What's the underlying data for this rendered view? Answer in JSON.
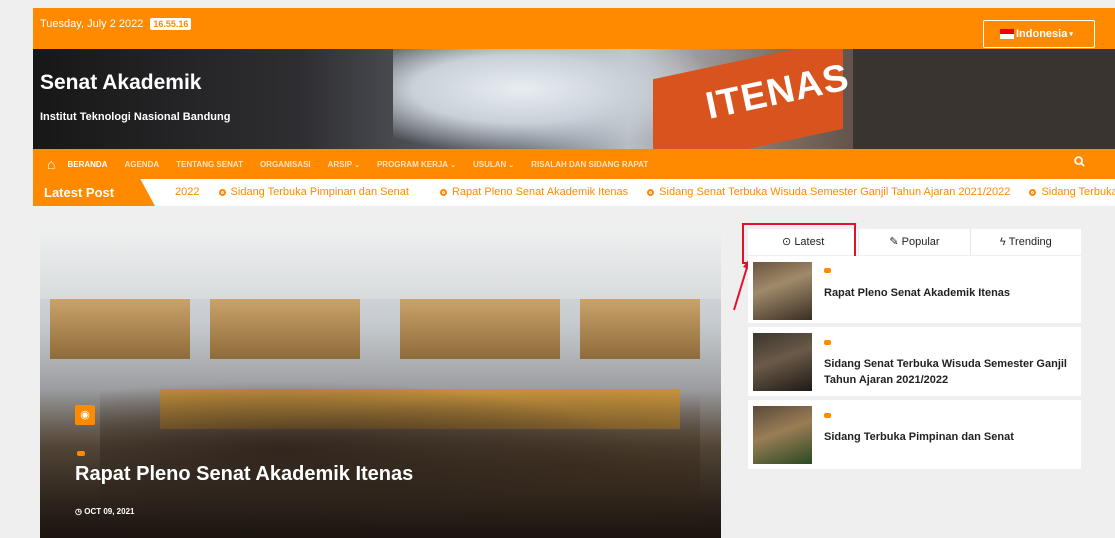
{
  "topbar": {
    "date": "Tuesday, July 2 2022",
    "time": "16.55.16",
    "language": "Indonesia"
  },
  "site": {
    "title": "Senat Akademik",
    "subtitle": "Institut Teknologi Nasional Bandung",
    "building_sign": "ITENAS"
  },
  "nav": {
    "home_icon": "home-icon",
    "items": [
      {
        "label": "Beranda",
        "active": true,
        "dropdown": false
      },
      {
        "label": "Agenda",
        "dropdown": false
      },
      {
        "label": "Tentang Senat",
        "dropdown": false
      },
      {
        "label": "Organisasi",
        "dropdown": false
      },
      {
        "label": "Arsip",
        "dropdown": true
      },
      {
        "label": "Program Kerja",
        "dropdown": true
      },
      {
        "label": "Usulan",
        "dropdown": true
      },
      {
        "label": "Risalah dan Sidang Rapat",
        "dropdown": false
      }
    ],
    "search_icon": "search-icon"
  },
  "ticker": {
    "label": "Latest Post",
    "items": [
      "2022",
      "Sidang Terbuka Pimpinan dan Senat",
      "Rapat Pleno Senat Akademik Itenas",
      "Sidang Senat Terbuka Wisuda Semester Ganjil Tahun Ajaran 2021/2022",
      "Sidang Terbuka Pir"
    ]
  },
  "featured": {
    "title": "Rapat Pleno Senat Akademik Itenas",
    "date": "OCT 09, 2021"
  },
  "tabs": [
    {
      "label": "Latest",
      "icon": "clock-icon",
      "selected": true
    },
    {
      "label": "Popular",
      "icon": "fire-icon"
    },
    {
      "label": "Trending",
      "icon": "bolt-icon"
    }
  ],
  "posts": [
    {
      "title": "Rapat Pleno Senat Akademik Itenas"
    },
    {
      "title": "Sidang Senat Terbuka Wisuda Semester Ganjil Tahun Ajaran 2021/2022"
    },
    {
      "title": "Sidang Terbuka Pimpinan dan Senat"
    }
  ],
  "colors": {
    "accent": "#ff8a00",
    "annotation": "#e0112b"
  }
}
